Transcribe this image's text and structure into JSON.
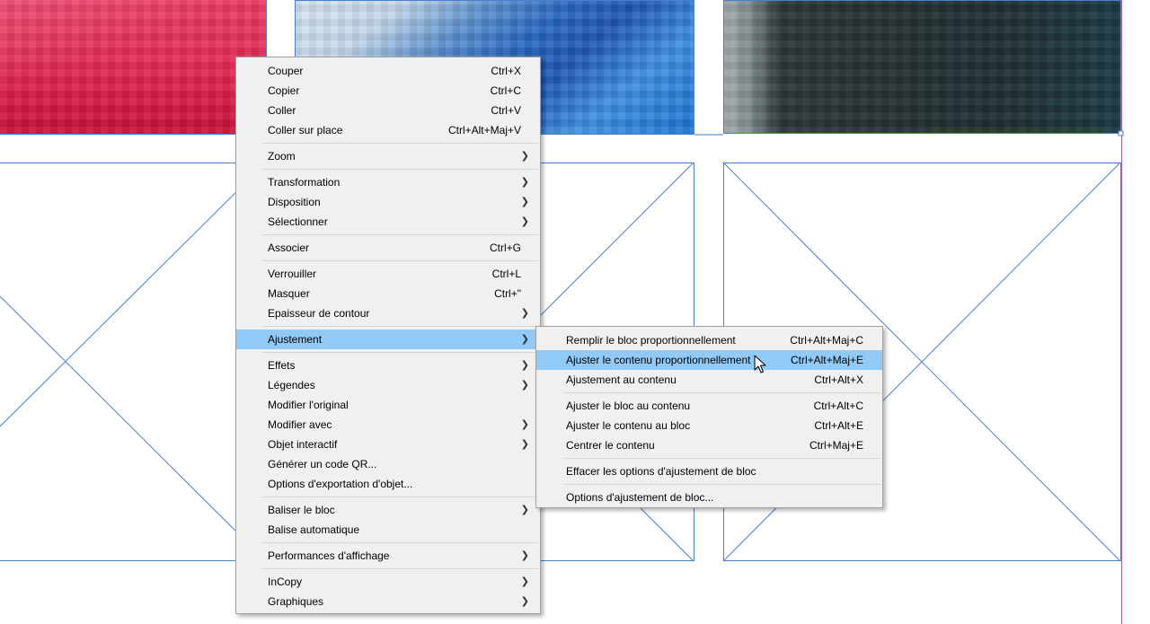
{
  "colors": {
    "menu_bg": "#f0f0f0",
    "highlight": "#91c9f7",
    "frame_line": "#4a7fcf"
  },
  "icons": {
    "submenu": "chevron-right-icon",
    "pointer": "mouse-pointer-icon"
  },
  "main_menu": {
    "items": [
      {
        "label": "Couper",
        "shortcut": "Ctrl+X",
        "submenu": false
      },
      {
        "label": "Copier",
        "shortcut": "Ctrl+C",
        "submenu": false
      },
      {
        "label": "Coller",
        "shortcut": "Ctrl+V",
        "submenu": false
      },
      {
        "label": "Coller sur place",
        "shortcut": "Ctrl+Alt+Maj+V",
        "submenu": false
      },
      {
        "label": "Zoom",
        "shortcut": "",
        "submenu": true
      },
      {
        "label": "Transformation",
        "shortcut": "",
        "submenu": true
      },
      {
        "label": "Disposition",
        "shortcut": "",
        "submenu": true
      },
      {
        "label": "Sélectionner",
        "shortcut": "",
        "submenu": true
      },
      {
        "label": "Associer",
        "shortcut": "Ctrl+G",
        "submenu": false
      },
      {
        "label": "Verrouiller",
        "shortcut": "Ctrl+L",
        "submenu": false
      },
      {
        "label": "Masquer",
        "shortcut": "Ctrl+\"",
        "submenu": false
      },
      {
        "label": "Epaisseur de contour",
        "shortcut": "",
        "submenu": true
      },
      {
        "label": "Ajustement",
        "shortcut": "",
        "submenu": true,
        "highlighted": true
      },
      {
        "label": "Effets",
        "shortcut": "",
        "submenu": true
      },
      {
        "label": "Légendes",
        "shortcut": "",
        "submenu": true
      },
      {
        "label": "Modifier l'original",
        "shortcut": "",
        "submenu": false
      },
      {
        "label": "Modifier avec",
        "shortcut": "",
        "submenu": true
      },
      {
        "label": "Objet interactif",
        "shortcut": "",
        "submenu": true
      },
      {
        "label": "Générer un code QR...",
        "shortcut": "",
        "submenu": false
      },
      {
        "label": "Options d'exportation d'objet...",
        "shortcut": "",
        "submenu": false
      },
      {
        "label": "Baliser le bloc",
        "shortcut": "",
        "submenu": true
      },
      {
        "label": "Balise automatique",
        "shortcut": "",
        "submenu": false
      },
      {
        "label": "Performances d'affichage",
        "shortcut": "",
        "submenu": true
      },
      {
        "label": "InCopy",
        "shortcut": "",
        "submenu": true
      },
      {
        "label": "Graphiques",
        "shortcut": "",
        "submenu": true
      }
    ]
  },
  "sub_menu": {
    "items": [
      {
        "label": "Remplir le bloc proportionnellement",
        "shortcut": "Ctrl+Alt+Maj+C"
      },
      {
        "label": "Ajuster le contenu proportionnellement",
        "shortcut": "Ctrl+Alt+Maj+E",
        "highlighted": true
      },
      {
        "label": "Ajustement au contenu",
        "shortcut": "Ctrl+Alt+X"
      },
      {
        "label": "Ajuster le bloc au contenu",
        "shortcut": "Ctrl+Alt+C"
      },
      {
        "label": "Ajuster le contenu au bloc",
        "shortcut": "Ctrl+Alt+E"
      },
      {
        "label": "Centrer le contenu",
        "shortcut": "Ctrl+Maj+E"
      },
      {
        "label": "Effacer les options d'ajustement de bloc",
        "shortcut": ""
      },
      {
        "label": "Options d'ajustement de bloc...",
        "shortcut": ""
      }
    ]
  }
}
